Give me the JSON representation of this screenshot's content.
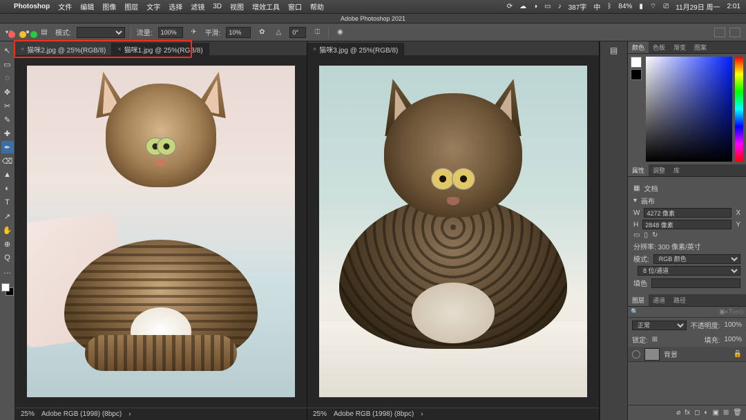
{
  "mac": {
    "app": "Photoshop",
    "menus": [
      "文件",
      "编辑",
      "图像",
      "图层",
      "文字",
      "选择",
      "滤镜",
      "3D",
      "视图",
      "增效工具",
      "窗口",
      "帮助"
    ],
    "right": {
      "chars": "387字",
      "battery": "84%",
      "wifi": "",
      "date": "11月29日 周一",
      "time": "2:01"
    }
  },
  "title": "Adobe Photoshop 2021",
  "optbar": {
    "mode_lbl": "模式:",
    "flow_lbl": "流量:",
    "flow_val": "100%",
    "smooth_lbl": "平滑:",
    "smooth_val": "10%",
    "angle_lbl": "",
    "angle_val": "0°"
  },
  "tools": [
    "↖",
    "▭",
    "◌",
    "✥",
    "✂",
    "✎",
    "✚",
    "✒",
    "⌫",
    "▲",
    "◐",
    "T",
    "↗",
    "✋",
    "⊕",
    "Q",
    "…"
  ],
  "docs": {
    "left": {
      "tabs": [
        {
          "name": "猫咪2.jpg @ 25%(RGB/8)",
          "active": false
        },
        {
          "name": "猫咪1.jpg @ 25%(RGB/8)",
          "active": true
        }
      ],
      "zoom": "25%",
      "profile": "Adobe RGB (1998) (8bpc)"
    },
    "right": {
      "tabs": [
        {
          "name": "猫咪3.jpg @ 25%(RGB/8)",
          "active": true
        }
      ],
      "zoom": "25%",
      "profile": "Adobe RGB (1998) (8bpc)"
    }
  },
  "panels": {
    "color": {
      "tabs": [
        "颜色",
        "色板",
        "渐变",
        "图案"
      ]
    },
    "props": {
      "tabs": [
        "属性",
        "调整",
        "库"
      ],
      "title": "文档",
      "canvas_lbl": "画布",
      "w_lbl": "W",
      "w_val": "4272 像素",
      "x_lbl": "X",
      "h_lbl": "H",
      "h_val": "2848 像素",
      "y_lbl": "Y",
      "res": "分辨率: 300 像素/英寸",
      "mode_lbl": "模式:",
      "mode_val": "RGB 颜色",
      "depth_val": "8 位/通道",
      "fill_lbl": "填色"
    },
    "layers": {
      "tabs": [
        "图层",
        "通道",
        "路径"
      ],
      "blend": "正常",
      "opacity_lbl": "不透明度:",
      "opacity_val": "100%",
      "lock_lbl": "锁定:",
      "fill_lbl": "填充:",
      "fill_val": "100%",
      "layer_name": "背景"
    }
  }
}
